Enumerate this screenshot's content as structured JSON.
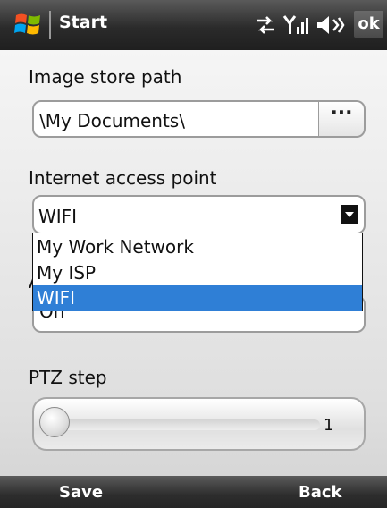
{
  "title_bar": {
    "title": "Start",
    "ok_label": "ok",
    "icons": [
      "windows-flag-icon",
      "sync-arrows-icon",
      "signal-strength-icon",
      "speaker-muted-icon"
    ]
  },
  "settings": {
    "image_store": {
      "label": "Image store path",
      "value": "\\My Documents\\",
      "browse_label": "···"
    },
    "internet_access": {
      "label": "Internet access point",
      "selected": "WIFI",
      "options": [
        "My Work Network",
        "My ISP",
        "WIFI"
      ]
    },
    "obscured_setting": {
      "label_fragment": "A",
      "value": "On"
    },
    "ptz_step": {
      "label": "PTZ step",
      "value": "1"
    }
  },
  "softkeys": {
    "left": "Save",
    "right": "Back"
  },
  "colors": {
    "selection": "#2f7fd6",
    "titlebar": "#2b2b2b"
  }
}
